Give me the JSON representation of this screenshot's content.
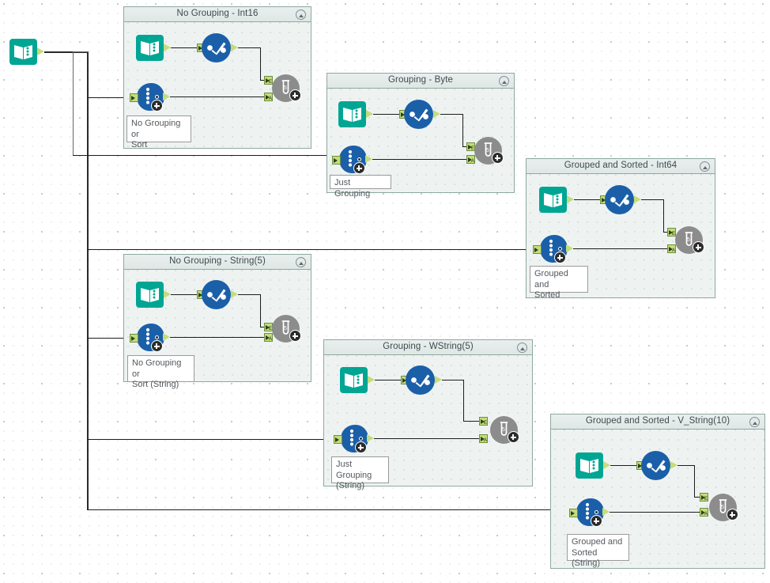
{
  "app": {
    "type": "workflow-canvas",
    "background": "#ffffff",
    "grid_dot_color": "#c9c9c9"
  },
  "colors": {
    "input_tool": "#00a693",
    "select_tool": "#1b5fa8",
    "generate_tool": "#1b5fa8",
    "test_tool": "#8c8c8c",
    "port": "#c3dd7a",
    "container_border": "#8fa8a0",
    "container_fill": "#eef3f2",
    "wire": "#1c1c1c"
  },
  "source": {
    "name": "input-data-tool",
    "icon": "input-data-icon"
  },
  "containers": [
    {
      "id": "c1",
      "title": "No Grouping - Int16",
      "comment": "No Grouping or\nSort",
      "collapse_icon": "chevron-up-icon",
      "tools": {
        "input": "input-data-icon",
        "select": "select-icon",
        "generate": "generate-rows-icon",
        "test": "test-icon"
      }
    },
    {
      "id": "c2",
      "title": "Grouping - Byte",
      "comment": "Just Grouping",
      "collapse_icon": "chevron-up-icon",
      "tools": {
        "input": "input-data-icon",
        "select": "select-icon",
        "generate": "generate-rows-icon",
        "test": "test-icon"
      }
    },
    {
      "id": "c3",
      "title": "Grouped and Sorted - Int64",
      "comment": "Grouped and\nSorted",
      "collapse_icon": "chevron-up-icon",
      "tools": {
        "input": "input-data-icon",
        "select": "select-icon",
        "generate": "generate-rows-icon",
        "test": "test-icon"
      }
    },
    {
      "id": "c4",
      "title": "No Grouping - String(5)",
      "comment": "No Grouping or\nSort (String)",
      "collapse_icon": "chevron-up-icon",
      "tools": {
        "input": "input-data-icon",
        "select": "select-icon",
        "generate": "generate-rows-icon",
        "test": "test-icon"
      }
    },
    {
      "id": "c5",
      "title": "Grouping - WString(5)",
      "comment": "Just Grouping\n(String)",
      "collapse_icon": "chevron-up-icon",
      "tools": {
        "input": "input-data-icon",
        "select": "select-icon",
        "generate": "generate-rows-icon",
        "test": "test-icon"
      }
    },
    {
      "id": "c6",
      "title": "Grouped and Sorted - V_String(10)",
      "comment": "Grouped and\nSorted (String)",
      "collapse_icon": "chevron-up-icon",
      "tools": {
        "input": "input-data-icon",
        "select": "select-icon",
        "generate": "generate-rows-icon",
        "test": "test-icon"
      }
    }
  ],
  "ports": {
    "expected_label": "E",
    "actual_label": "A"
  }
}
